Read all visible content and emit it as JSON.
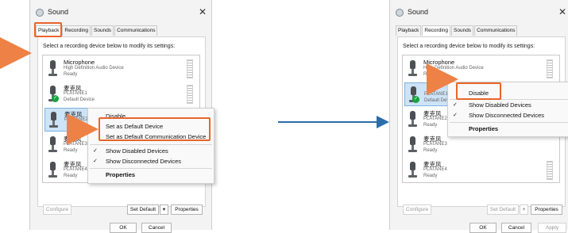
{
  "left": {
    "title": "Sound",
    "tabs": [
      "Playback",
      "Recording",
      "Sounds",
      "Communications"
    ],
    "prompt": "Select a recording device below to modify its settings:",
    "devices": [
      {
        "name": "Microphone",
        "sub": "High Definition Audio Device",
        "state": "Ready"
      },
      {
        "name": "麦克风",
        "sub": "PLATANE1",
        "state": "Default Device"
      },
      {
        "name": "麦克风",
        "sub": "PLATANE2",
        "state": ""
      },
      {
        "name": "麦克风",
        "sub": "PLATANE3",
        "state": "Ready"
      },
      {
        "name": "麦克风",
        "sub": "PLATANE4",
        "state": "Ready"
      }
    ],
    "menu": {
      "disable": "Disable",
      "set_default": "Set as Default Device",
      "set_default_comm": "Set as Default Communication Device",
      "show_disabled": "Show Disabled Devices",
      "show_disconnected": "Show Disconnected Devices",
      "properties": "Properties"
    },
    "buttons": {
      "configure": "Configure",
      "set_default": "Set Default",
      "properties": "Properties",
      "ok": "OK",
      "cancel": "Cancel"
    }
  },
  "right": {
    "title": "Sound",
    "tabs": [
      "Playback",
      "Recording",
      "Sounds",
      "Communications"
    ],
    "prompt": "Select a recording device below to modify its settings:",
    "devices": [
      {
        "name": "Microphone",
        "sub": "High Definition Audio Device",
        "state": "Ready"
      },
      {
        "name": "",
        "sub": "PLATANE1",
        "state": "Default Dev"
      },
      {
        "name": "麦克风",
        "sub": "PLATANE2",
        "state": "Ready"
      },
      {
        "name": "麦克风",
        "sub": "PLATANE3",
        "state": "Ready"
      },
      {
        "name": "麦克风",
        "sub": "PLATANE4",
        "state": "Ready"
      }
    ],
    "menu": {
      "disable": "Disable",
      "show_disabled": "Show Disabled Devices",
      "show_disconnected": "Show Disconnected Devices",
      "properties": "Properties"
    },
    "buttons": {
      "configure": "Configure",
      "set_default": "Set Default",
      "properties": "Properties",
      "ok": "OK",
      "cancel": "Cancel",
      "apply": "Apply"
    }
  },
  "colors": {
    "highlight": "#e9642b",
    "pointer": "#ee8146",
    "connector": "#2c6ea8",
    "selection": "#cde3f7",
    "default_check": "#18a33f"
  },
  "icons": {
    "title": "sound-icon",
    "device": "microphone-icon",
    "default": "check-badge-icon",
    "pointer": "orange-pointer-triangle",
    "connector": "blue-arrow"
  }
}
